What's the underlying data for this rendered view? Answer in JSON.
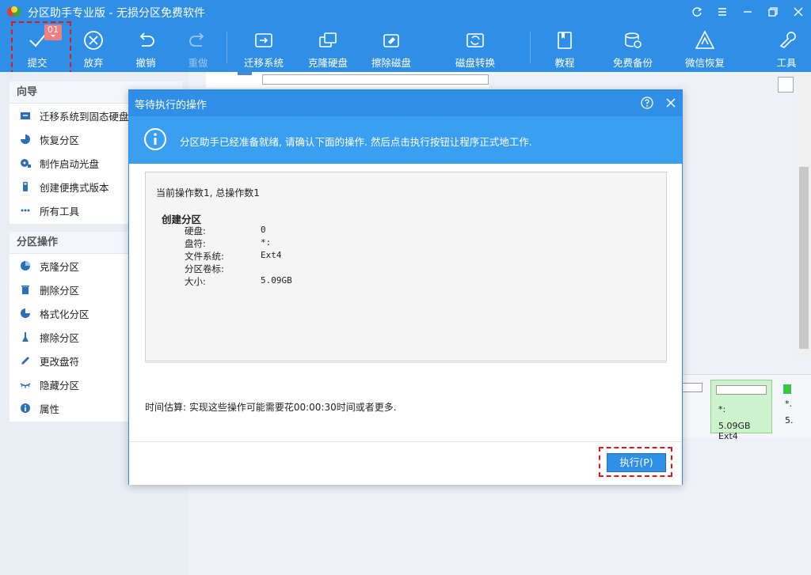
{
  "window": {
    "title": "分区助手专业版 - 无损分区免费软件"
  },
  "toolbar": {
    "commit": {
      "label": "提交",
      "badge": "01"
    },
    "discard": {
      "label": "放弃"
    },
    "undo": {
      "label": "撤销"
    },
    "redo": {
      "label": "重做"
    },
    "migrate_os": {
      "label": "迁移系统"
    },
    "clone_disk": {
      "label": "克隆硬盘"
    },
    "wipe_disk": {
      "label": "擦除磁盘"
    },
    "convert_disk": {
      "label": "磁盘转换"
    },
    "tutorial": {
      "label": "教程"
    },
    "free_backup": {
      "label": "免费备份"
    },
    "wechat_recovery": {
      "label": "微信恢复"
    },
    "tools": {
      "label": "工具"
    }
  },
  "sidebar": {
    "wizard_section": {
      "header": "向导",
      "items": [
        {
          "label": "迁移系统到固态硬盘",
          "icon": "migrate-ssd-icon"
        },
        {
          "label": "恢复分区",
          "icon": "recover-partition-icon"
        },
        {
          "label": "制作启动光盘",
          "icon": "boot-disc-icon"
        },
        {
          "label": "创建便携式版本",
          "icon": "portable-usb-icon"
        },
        {
          "label": "所有工具",
          "icon": "all-tools-icon"
        }
      ]
    },
    "partition_section": {
      "header": "分区操作",
      "items": [
        {
          "label": "克隆分区",
          "icon": "clone-partition-icon"
        },
        {
          "label": "删除分区",
          "icon": "delete-partition-icon"
        },
        {
          "label": "格式化分区",
          "icon": "format-partition-icon"
        },
        {
          "label": "擦除分区",
          "icon": "wipe-partition-icon"
        },
        {
          "label": "更改盘符",
          "icon": "change-letter-icon"
        },
        {
          "label": "隐藏分区",
          "icon": "hide-partition-icon"
        },
        {
          "label": "属性",
          "icon": "properties-icon"
        }
      ]
    }
  },
  "disk_map": {
    "partition": {
      "letter": "*:",
      "size_fs": "5.09GB Ext4"
    },
    "next_partition": {
      "letter": "*.",
      "size": "5."
    }
  },
  "dialog": {
    "title": "等待执行的操作",
    "banner_message": "分区助手已经准备就绪, 请确认下面的操作. 然后点击执行按钮让程序正式地工作.",
    "count_line": "当前操作数1, 总操作数1",
    "operation": {
      "title": "创建分区",
      "rows": [
        {
          "key": "硬盘:",
          "value": "0"
        },
        {
          "key": "盘符:",
          "value": "*:"
        },
        {
          "key": "文件系统:",
          "value": "Ext4"
        },
        {
          "key": "分区卷标:",
          "value": ""
        },
        {
          "key": "大小:",
          "value": "5.09GB"
        }
      ]
    },
    "time_estimate": "时间估算: 实现这些操作可能需要花00:00:30时间或者更多.",
    "execute_button": "执行(P)"
  },
  "colors": {
    "accent": "#2f8ee6",
    "banner": "#3a9ff0",
    "highlight": "#e8141c",
    "partition_fill": "#ccf3cc"
  }
}
